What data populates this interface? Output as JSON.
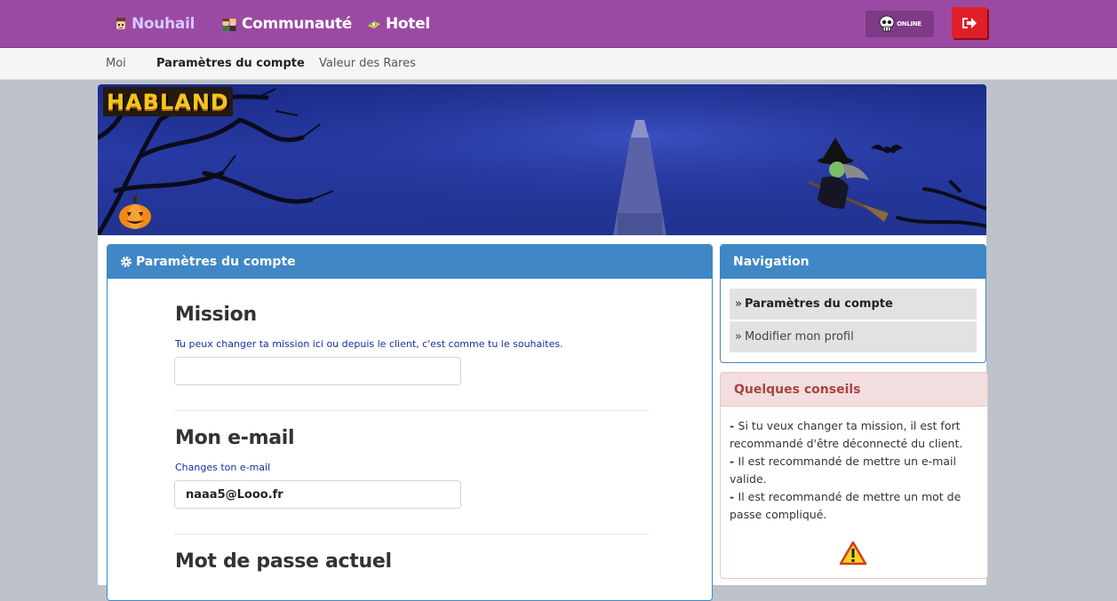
{
  "topnav": {
    "items": [
      {
        "label": "Nouhail",
        "icon": "avatar-head-icon",
        "active": true
      },
      {
        "label": "Communauté",
        "icon": "community-icon",
        "active": false
      },
      {
        "label": "Hotel",
        "icon": "hotel-icon",
        "active": false
      }
    ],
    "online_label": "ONLINE"
  },
  "subnav": {
    "items": [
      {
        "label": "Moi"
      },
      {
        "label": "Paramètres du compte"
      },
      {
        "label": "Valeur des Rares"
      }
    ]
  },
  "banner": {
    "logo_text": "HABLAND"
  },
  "main_panel": {
    "title": "Paramètres du compte",
    "sections": [
      {
        "title": "Mission",
        "help": "Tu peux changer ta mission ici ou depuis le client, c'est comme tu le souhaites.",
        "value": ""
      },
      {
        "title": "Mon e-mail",
        "help": "Changes ton e-mail",
        "value": "naaa5@Looo.fr"
      },
      {
        "title": "Mot de passe actuel"
      }
    ]
  },
  "navigation": {
    "title": "Navigation",
    "links": [
      {
        "label": "Paramètres du compte",
        "active": true
      },
      {
        "label": "Modifier mon profil",
        "active": false
      }
    ]
  },
  "tips": {
    "title": "Quelques conseils",
    "items": [
      "Si tu veux changer ta mission, il est fort recommandé d'être déconnecté du client.",
      "Il est recommandé de mettre un e-mail valide.",
      "Il est recommandé de mettre un mot de passe compliqué."
    ]
  },
  "colors": {
    "topbar": "#9b4aa3",
    "panel_primary": "#3f87c5",
    "tips_header": "#f2dede",
    "tips_text": "#a94442",
    "help_text": "#1b2ca8",
    "logout": "#e01f28"
  }
}
